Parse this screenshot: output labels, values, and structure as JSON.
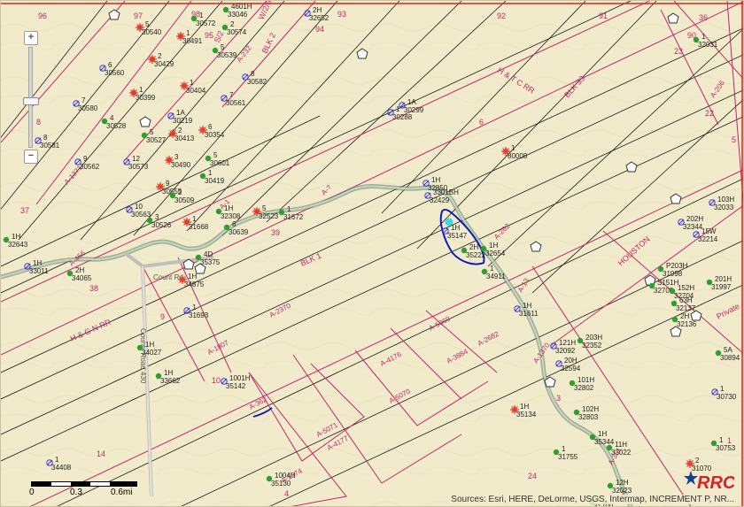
{
  "map": {
    "survey_lines": [
      "H & T C RR",
      "BLK 33",
      "BLK 1",
      "H & G N RR",
      "HOUSTON",
      "Private",
      "A-232",
      "A-1371",
      "A-2370",
      "A-1807",
      "A-2682",
      "A-3884",
      "A-4176",
      "A-5069",
      "A-5070",
      "A-5071",
      "A-4177",
      "A-362",
      "A-1274",
      "A-13",
      "A-262",
      "A-456",
      "A-351",
      "A-1370",
      "A-?",
      "A-1",
      "A-206",
      "BLK 2",
      "W/2/6",
      "S/2"
    ],
    "section_numbers": [
      "96",
      "97",
      "98",
      "95",
      "94",
      "93",
      "92",
      "91",
      "23",
      "90",
      "22",
      "36",
      "37",
      "38",
      "39",
      "9",
      "10",
      "14",
      "4",
      "3",
      "24",
      "1",
      "2",
      "5",
      "6",
      "8"
    ],
    "road_labels": [
      "County Road 430",
      "Count Rd"
    ],
    "wells": [
      {
        "id": "5",
        "api": "30540"
      },
      {
        "id": "1",
        "api": "30491"
      },
      {
        "id": "4601H",
        "api": "33046"
      },
      {
        "id": "2",
        "api": "30574"
      },
      {
        "id": "1",
        "api": "30572"
      },
      {
        "id": "2H",
        "api": "32652"
      },
      {
        "id": "6",
        "api": "30560"
      },
      {
        "id": "2",
        "api": "30429"
      },
      {
        "id": "5",
        "api": "30539"
      },
      {
        "id": "8",
        "api": "30582"
      },
      {
        "id": "1",
        "api": "30404"
      },
      {
        "id": "7",
        "api": "30580"
      },
      {
        "id": "1",
        "api": "30399"
      },
      {
        "id": "7",
        "api": "30561"
      },
      {
        "id": "1A",
        "api": "30299"
      },
      {
        "id": "4",
        "api": "30528"
      },
      {
        "id": "1A",
        "api": "30219"
      },
      {
        "id": "6",
        "api": "30354"
      },
      {
        "id": "1",
        "api": "30288"
      },
      {
        "id": "5",
        "api": "30527"
      },
      {
        "id": "2",
        "api": "30413"
      },
      {
        "id": "8",
        "api": "30581"
      },
      {
        "id": "9",
        "api": "30562"
      },
      {
        "id": "12",
        "api": "30573"
      },
      {
        "id": "3",
        "api": "30490"
      },
      {
        "id": "5",
        "api": "30601"
      },
      {
        "id": "1",
        "api": "80008"
      },
      {
        "id": "1",
        "api": "30419"
      },
      {
        "id": "9",
        "api": "30555"
      },
      {
        "id": "1H",
        "api": "32850"
      },
      {
        "id": "3301BH",
        "api": "32429"
      },
      {
        "id": "10",
        "api": "30563"
      },
      {
        "id": "2",
        "api": "30509"
      },
      {
        "id": "1H",
        "api": "32308"
      },
      {
        "id": "1",
        "api": "31672"
      },
      {
        "id": "5",
        "api": "32523"
      },
      {
        "id": "3",
        "api": "30526"
      },
      {
        "id": "1",
        "api": "31668"
      },
      {
        "id": "6",
        "api": "30639"
      },
      {
        "id": "1H",
        "api": "35147"
      },
      {
        "id": "2H",
        "api": "35222"
      },
      {
        "id": "1H",
        "api": "32654"
      },
      {
        "id": "1H",
        "api": "32643"
      },
      {
        "id": "4D",
        "api": "35375"
      },
      {
        "id": "1H",
        "api": "33011"
      },
      {
        "id": "2H",
        "api": "34065"
      },
      {
        "id": "1H",
        "api": "34875"
      },
      {
        "id": "1",
        "api": "34911"
      },
      {
        "id": "1",
        "api": "31693"
      },
      {
        "id": "1H",
        "api": "34027"
      },
      {
        "id": "1H",
        "api": "31611"
      },
      {
        "id": "121H",
        "api": "32092"
      },
      {
        "id": "20H",
        "api": "32594"
      },
      {
        "id": "1H",
        "api": "33662"
      },
      {
        "id": "1001H",
        "api": "35142"
      },
      {
        "id": "1H",
        "api": "35134"
      },
      {
        "id": "101H",
        "api": "32802"
      },
      {
        "id": "102H",
        "api": "32803"
      },
      {
        "id": "1H",
        "api": "35344"
      },
      {
        "id": "1",
        "api": "34408"
      },
      {
        "id": "1",
        "api": "31755"
      },
      {
        "id": "11H",
        "api": "33022"
      },
      {
        "id": "1004H",
        "api": "35130"
      },
      {
        "id": "12H",
        "api": "32023"
      },
      {
        "id": "1",
        "api": "31700"
      },
      {
        "id": "203H",
        "api": "32352"
      },
      {
        "id": "202H",
        "api": "32344"
      },
      {
        "id": "15W",
        "api": "32214"
      },
      {
        "id": "P203H",
        "api": "31998"
      },
      {
        "id": "S151H",
        "api": "32703"
      },
      {
        "id": "152H",
        "api": "32704"
      },
      {
        "id": "63H",
        "api": "32137"
      },
      {
        "id": "2H",
        "api": "32136"
      },
      {
        "id": "201H",
        "api": "31997"
      },
      {
        "id": "103H",
        "api": "32033"
      },
      {
        "id": "1",
        "api": "32031"
      },
      {
        "id": "5A",
        "api": "30894"
      },
      {
        "id": "1",
        "api": "30730"
      },
      {
        "id": "1",
        "api": "30753"
      },
      {
        "id": "2",
        "api": "31070"
      }
    ],
    "colors": {
      "background": "#f1ebcb",
      "survey_line": "#c0266a",
      "grid_line": "#1a1a1a",
      "creek": "#5c7e78",
      "well_oil": "#2e9e2e",
      "well_gas": "#e33b2a",
      "well_permit": "#3a3ad6",
      "annotation": "#0b1fb8",
      "highlight": "#3fd6e6"
    }
  },
  "controls": {
    "zoom_in_label": "+",
    "zoom_out_label": "−",
    "zoom_level_fraction": 0.45
  },
  "scalebar": {
    "labels": [
      "0",
      "0.3",
      "0.6mi"
    ]
  },
  "attribution": {
    "text": "Sources: Esri, HERE, DeLorme, USGS, Intermap, INCREMENT P, NR..."
  },
  "logo": {
    "text": "RRC",
    "colors": [
      "#1b3f8f",
      "#d2232a"
    ]
  }
}
